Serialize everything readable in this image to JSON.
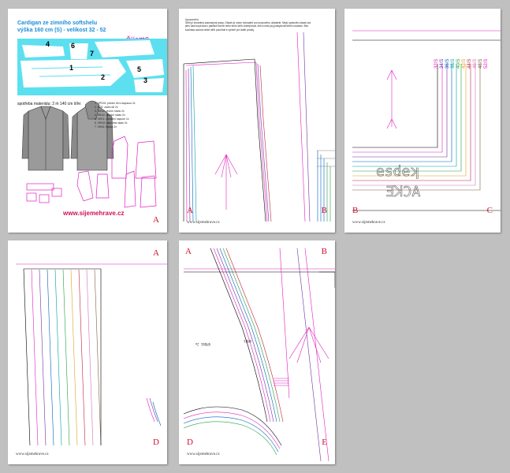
{
  "page1": {
    "title_line1": "Cardigan ze zimního softshelu",
    "title_line2": "výška 160 cm (S) - velikost 32 - 52",
    "brand": "Šijeme hravě",
    "consumption": "spotřeba materiálu: 2 m 140 cm šíře:",
    "layout_numbers": [
      "4",
      "6",
      "7",
      "1",
      "2",
      "3",
      "5"
    ],
    "parts": [
      "1. VPD01: přední díl s kapucou 2x",
      "2. ZZD: zadní díl 2x",
      "3. VRU2: vrchní rukáv 2x",
      "4. SRU2: spodní rukáv 2x",
      "5. VEK1: obložení kapuce 1x",
      "6. VRU3: manžeta rukáv 2x",
      "7. VKA1: kapsa 2x"
    ],
    "url": "www.sijemehrave.cz",
    "corner": "A"
  },
  "page2": {
    "text_title": "Upozornění:",
    "text_body": "Střih je chráněný autorskými právy. Obsah je určen výhradně pro koncového uživatele. Nejsi oprávněn obsah ani jeho část kopírovat v jakékoli formě nebo tento střih zveřejňovat, šířit a nebo jej poskytovat třetím osobám. Bez souhlasu autora nelze střih používat k výrobě pro další prodej.",
    "corner_left": "A",
    "corner_right": "B",
    "footer": "www.sijemehrave.cz"
  },
  "page3": {
    "sizes": [
      "32/S",
      "34/S",
      "36/S",
      "38/S",
      "40/S",
      "42/S",
      "44/S",
      "46/S",
      "48/S",
      "52/S"
    ],
    "corner_left": "B",
    "corner_right": "C",
    "footer": "www.sijemehrave.cz"
  },
  "page4": {
    "corner_top": "A",
    "corner_bottom": "D",
    "footer": "www.sijemehrave.cz"
  },
  "page5": {
    "corner_top_left": "A",
    "corner_top_right": "B",
    "corner_bottom_left": "D",
    "corner_bottom_right": "E",
    "footer": "www.sijemehrave.cz"
  },
  "colors": {
    "background": "#c0c0c0",
    "page": "#ffffff",
    "magenta": "#e020c0",
    "cyan_layout": "#5ce0f0",
    "corner": "#d01030"
  }
}
